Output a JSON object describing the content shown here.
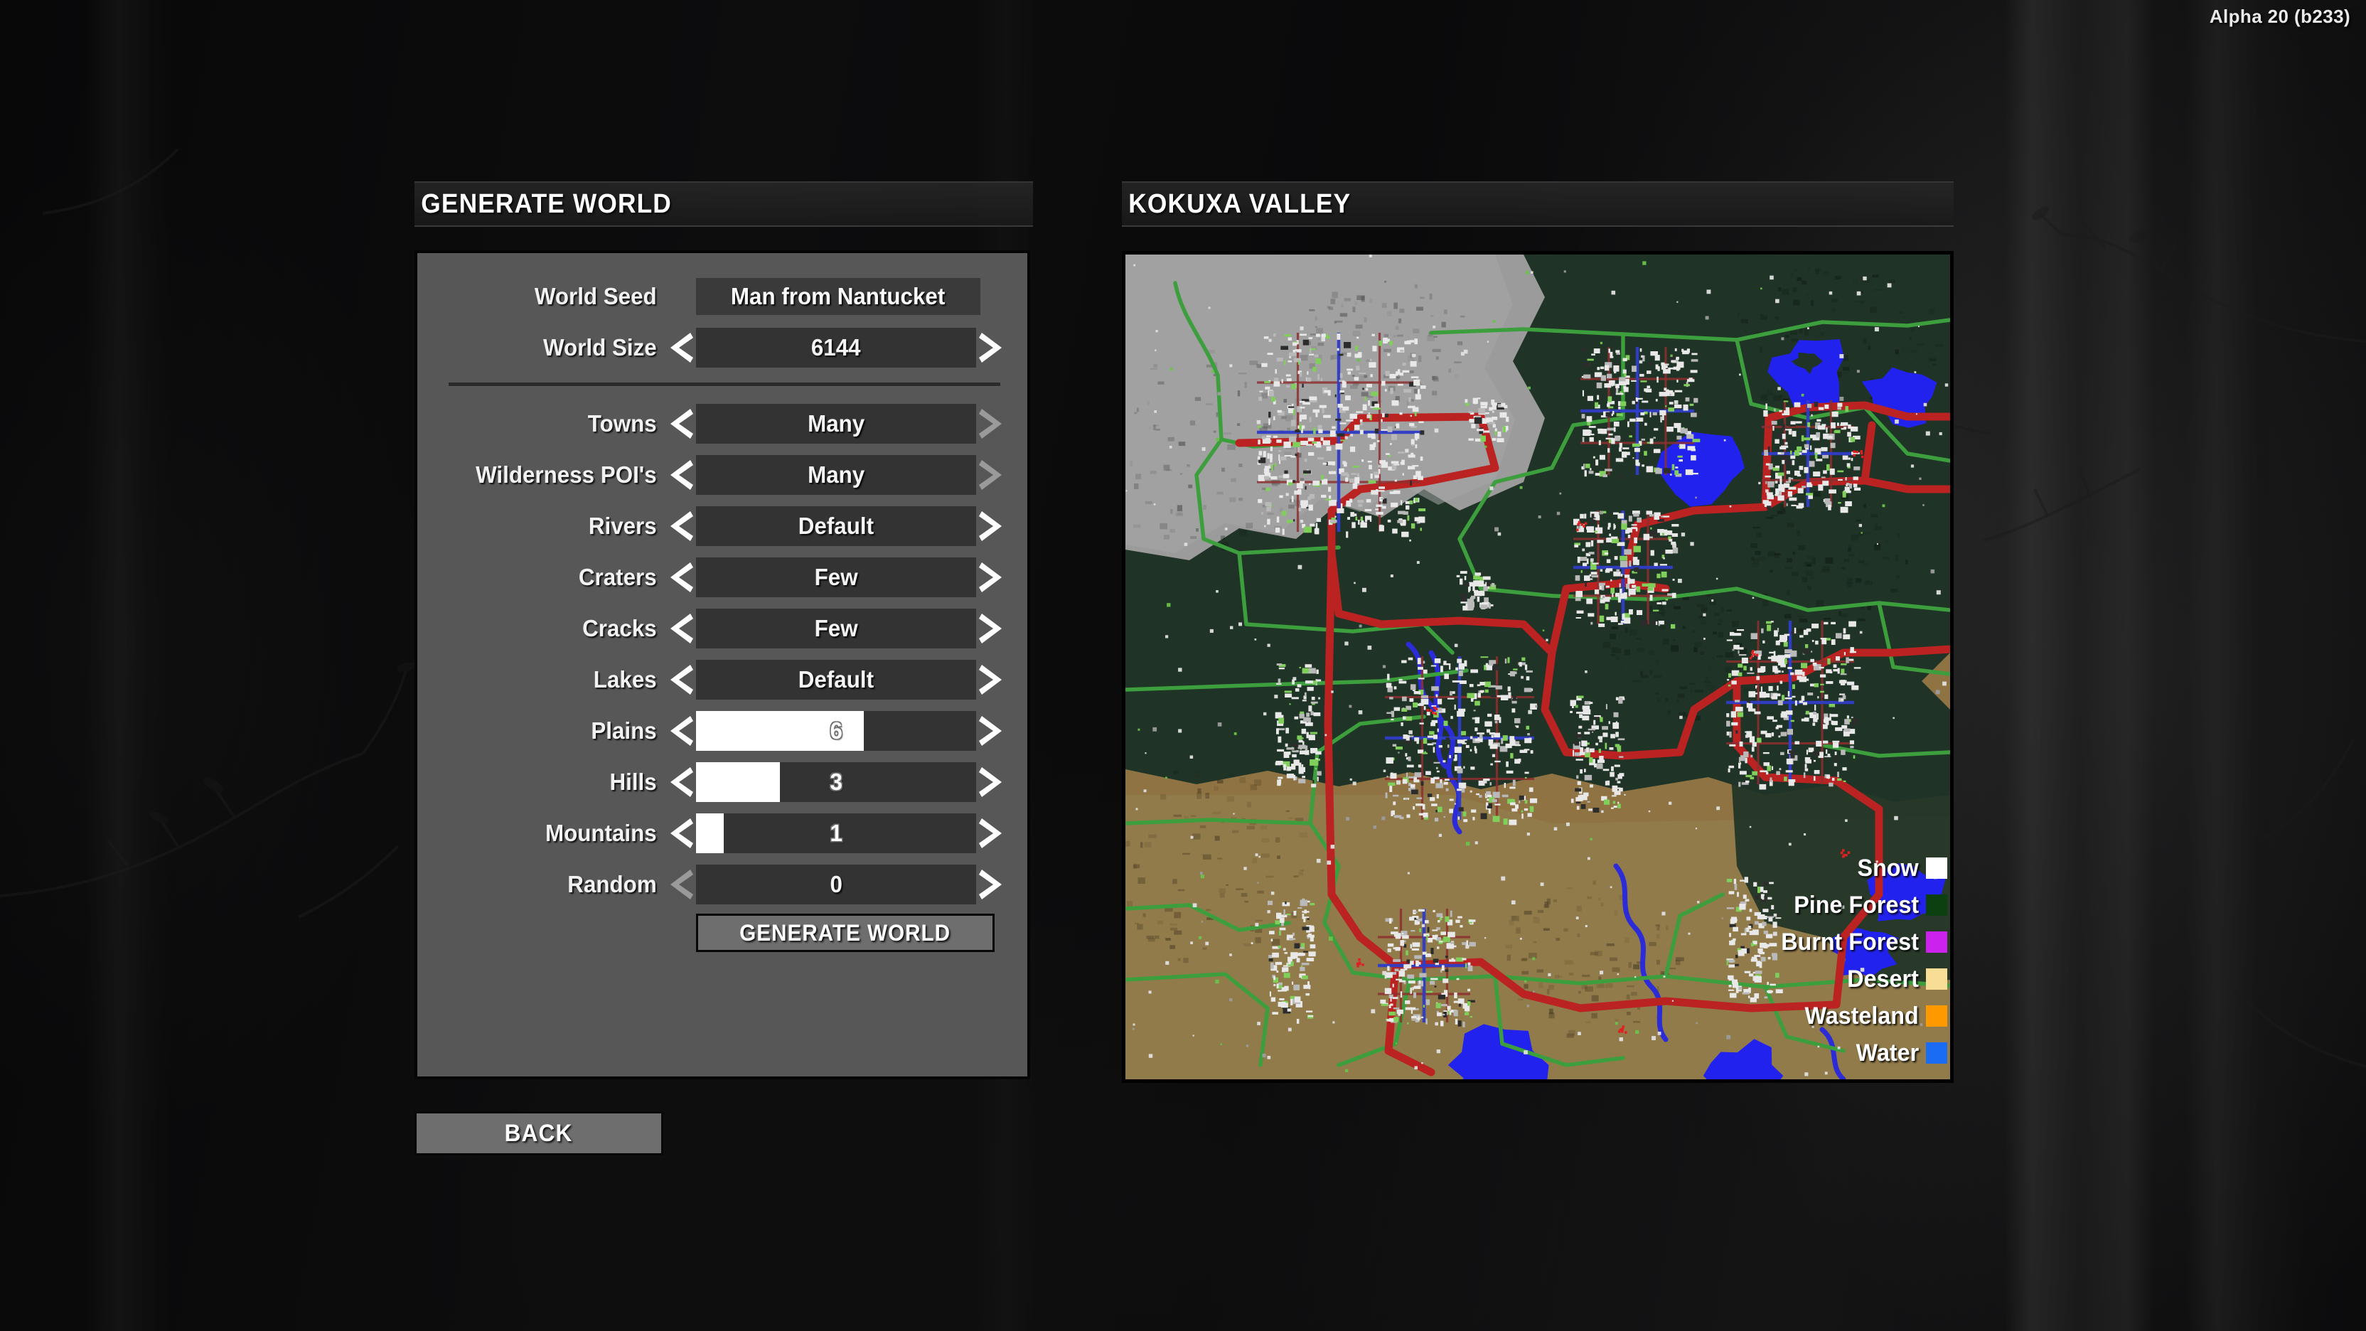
{
  "version": "Alpha 20 (b233)",
  "headers": {
    "left": "GENERATE WORLD",
    "right": "KOKUXA VALLEY"
  },
  "settings": {
    "seed": {
      "label": "World Seed",
      "value": "Man from Nantucket",
      "placeholder": "World Seed"
    },
    "size": {
      "label": "World Size",
      "value": "6144",
      "left_arrow": "chevron-left",
      "right_arrow": "chevron-right"
    },
    "options": [
      {
        "label": "Towns",
        "value": "Many",
        "type": "cycler",
        "left_enabled": true,
        "right_enabled": false
      },
      {
        "label": "Wilderness POI's",
        "value": "Many",
        "type": "cycler",
        "left_enabled": true,
        "right_enabled": false
      },
      {
        "label": "Rivers",
        "value": "Default",
        "type": "cycler",
        "left_enabled": true,
        "right_enabled": true
      },
      {
        "label": "Craters",
        "value": "Few",
        "type": "cycler",
        "left_enabled": true,
        "right_enabled": true
      },
      {
        "label": "Cracks",
        "value": "Few",
        "type": "cycler",
        "left_enabled": true,
        "right_enabled": true
      },
      {
        "label": "Lakes",
        "value": "Default",
        "type": "cycler",
        "left_enabled": true,
        "right_enabled": true
      },
      {
        "label": "Plains",
        "value": "6",
        "type": "slider",
        "fill_percent": 60,
        "left_enabled": true,
        "right_enabled": true
      },
      {
        "label": "Hills",
        "value": "3",
        "type": "slider",
        "fill_percent": 30,
        "left_enabled": true,
        "right_enabled": true
      },
      {
        "label": "Mountains",
        "value": "1",
        "type": "slider",
        "fill_percent": 10,
        "left_enabled": true,
        "right_enabled": true
      },
      {
        "label": "Random",
        "value": "0",
        "type": "slider",
        "fill_percent": 0,
        "left_enabled": false,
        "right_enabled": true
      }
    ]
  },
  "buttons": {
    "generate": "GENERATE WORLD",
    "back": "BACK"
  },
  "map": {
    "title": "KOKUXA VALLEY",
    "legend": [
      {
        "name": "Snow",
        "color": "#ffffff"
      },
      {
        "name": "Pine Forest",
        "color": "#0d4010"
      },
      {
        "name": "Burnt Forest",
        "color": "#cc22ee"
      },
      {
        "name": "Desert",
        "color": "#f7dd95"
      },
      {
        "name": "Wasteland",
        "color": "#ff9900"
      },
      {
        "name": "Water",
        "color": "#1b6cf5"
      }
    ],
    "colors": {
      "snow": "#9b9b9b",
      "pine_forest": "#1f3326",
      "desert": "#8f7342",
      "desert_light": "#938252",
      "water": "#2222ee",
      "highway": "#bb2222",
      "road": "#3d9e3d",
      "building": "#e8e8e8"
    }
  }
}
